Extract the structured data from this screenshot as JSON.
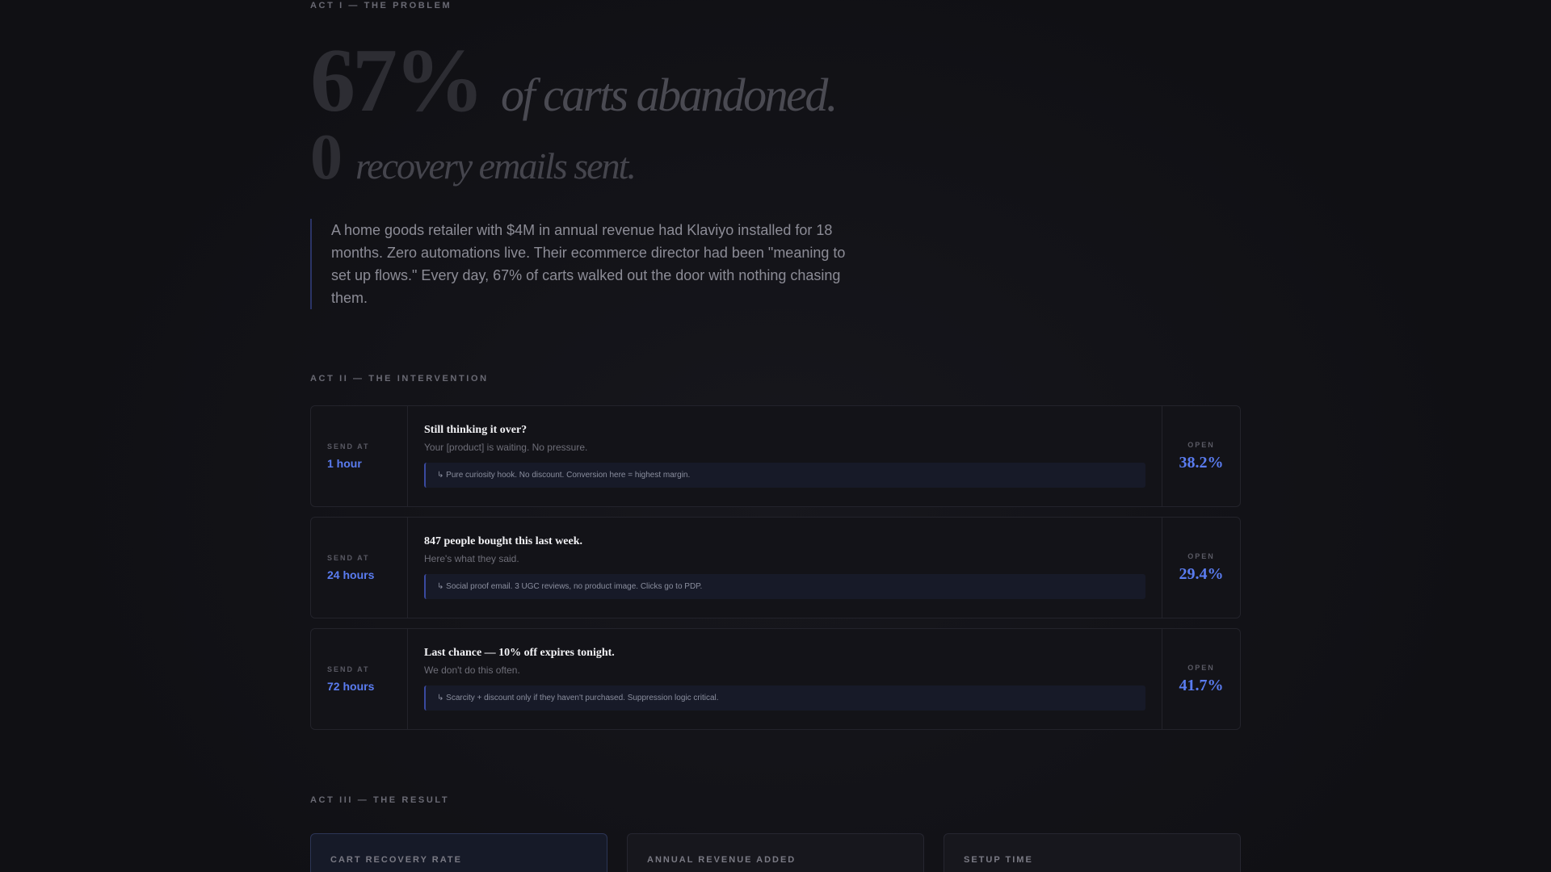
{
  "act1": {
    "label": "ACT I — THE PROBLEM",
    "stat1_number": "67%",
    "stat1_text": "of carts abandoned.",
    "stat2_number": "0",
    "stat2_text": "recovery emails sent.",
    "quote": "A home goods retailer with $4M in annual revenue had Klaviyo installed for 18 months. Zero automations live. Their ecommerce director had been \"meaning to set up flows.\" Every day, 67% of carts walked out the door with nothing chasing them."
  },
  "act2": {
    "label": "ACT II — THE INTERVENTION",
    "send_label": "SEND AT",
    "open_label": "OPEN",
    "steps": [
      {
        "when": "1 hour",
        "subject": "Still thinking it over?",
        "preview": "Your [product] is waiting. No pressure.",
        "note": "↳ Pure curiosity hook. No discount. Conversion here = highest margin.",
        "open": "38.2%"
      },
      {
        "when": "24 hours",
        "subject": "847 people bought this last week.",
        "preview": "Here's what they said.",
        "note": "↳ Social proof email. 3 UGC reviews, no product image. Clicks go to PDP.",
        "open": "29.4%"
      },
      {
        "when": "72 hours",
        "subject": "Last chance — 10% off expires tonight.",
        "preview": "We don't do this often.",
        "note": "↳ Scarcity + discount only if they haven't purchased. Suppression logic critical.",
        "open": "41.7%"
      }
    ]
  },
  "act3": {
    "label": "ACT III — THE RESULT",
    "cards": [
      {
        "label": "CART RECOVERY RATE"
      },
      {
        "label": "ANNUAL REVENUE ADDED"
      },
      {
        "label": "SETUP TIME"
      }
    ]
  },
  "colors": {
    "accent": "#5a7cf0",
    "background": "#111115"
  }
}
